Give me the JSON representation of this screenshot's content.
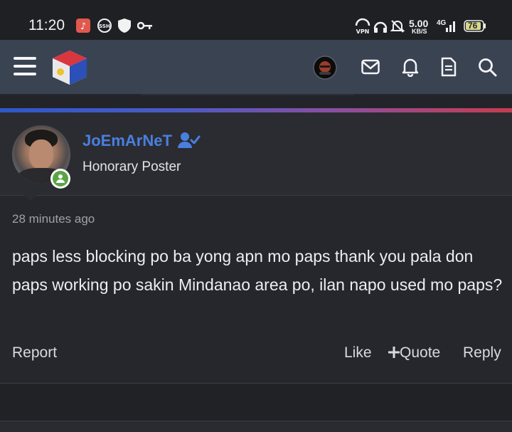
{
  "status_bar": {
    "time": "11:20",
    "network_speed": "5.00",
    "speed_unit": "KB/S",
    "network_type": "4G",
    "vpn_label": "VPN",
    "battery": "76",
    "icons": [
      "music-app-icon",
      "ssh-icon",
      "shield-icon",
      "key-icon",
      "vpn-icon",
      "headset-icon",
      "mute-bell-icon",
      "signal-icon",
      "battery-icon"
    ]
  },
  "header": {
    "icons": [
      "menu-icon",
      "site-logo",
      "user-avatar",
      "mail-icon",
      "bell-icon",
      "document-icon",
      "search-icon"
    ]
  },
  "post": {
    "username": "JoEmArNeT",
    "user_title": "Honorary Poster",
    "timestamp": "28 minutes ago",
    "message": "paps less blocking po ba yong apn mo paps thank you pala don paps working po sakin Mindanao area po, ilan napo used mo paps?",
    "actions": {
      "report": "Report",
      "like": "Like",
      "quote": "Quote",
      "reply": "Reply"
    }
  },
  "colors": {
    "username": "#4a7fe0",
    "header_bg": "#3a4352",
    "online": "#5aa446"
  }
}
